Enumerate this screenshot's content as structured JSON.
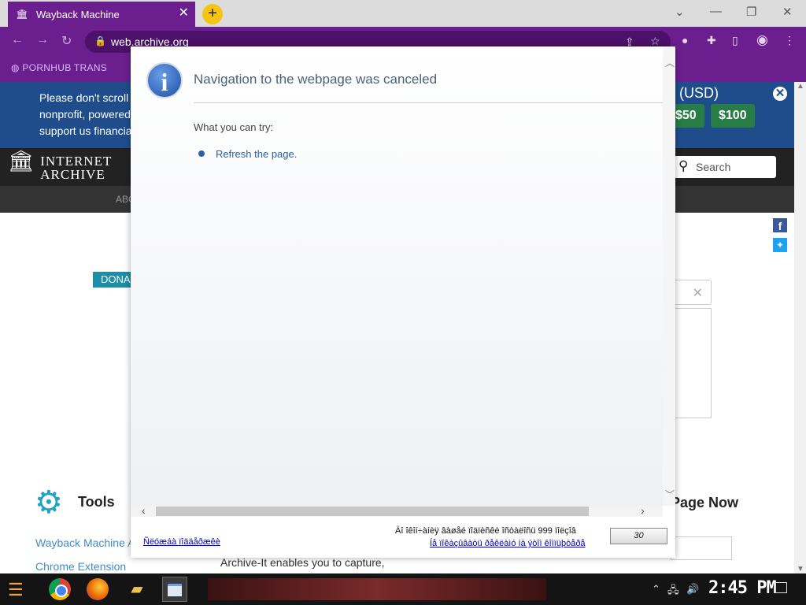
{
  "browser": {
    "tab_title": "Wayback Machine",
    "tab_close": "✕",
    "new_tab": "+",
    "url": "web.archive.org",
    "bookmark": "PORNHUB TRANS",
    "window_controls": {
      "dropdown": "⌄",
      "minimize": "—",
      "restore": "❐",
      "close": "✕"
    }
  },
  "page": {
    "banner_text": "Please don't scroll\nnonprofit, powered\nsupport us financia",
    "banner_currency": "? (USD)",
    "banner_buttons": [
      "$50",
      "$100"
    ],
    "banner_close": "✕",
    "logo_line1": "INTERNET",
    "logo_line2": "ARCHIVE",
    "search_placeholder": "Search",
    "nav_about": "ABO",
    "donate_label": "DONA",
    "tools_title": "Tools",
    "tool_links": [
      "Wayback Machine A",
      "Chrome Extension"
    ],
    "save_page_title": "Page Now",
    "archiveit_text": "Archive-It enables you to capture,"
  },
  "dialog": {
    "title": "Navigation to the webpage was canceled",
    "try_label": "What you can try:",
    "refresh_link": "Refresh the page.",
    "footer_left_link": "Ñëóæáà ïîääåðæêè",
    "footer_message": "Äî îêîí÷àíèÿ âàøåé ïîäïèñêè îñòàëîñü 999 ïîëçîâ",
    "footer_right_link": "Íå ïîêàçûâàòü ðåêëàìó íà ýòîì êîìïüþòåðå",
    "countdown": "30"
  },
  "taskbar": {
    "clock": "2:45 PM"
  },
  "colors": {
    "browser_purple": "#6b1f8f",
    "banner_blue": "#1f4d8c",
    "donate_green": "#287c46",
    "link_blue": "#2c5fa8"
  }
}
